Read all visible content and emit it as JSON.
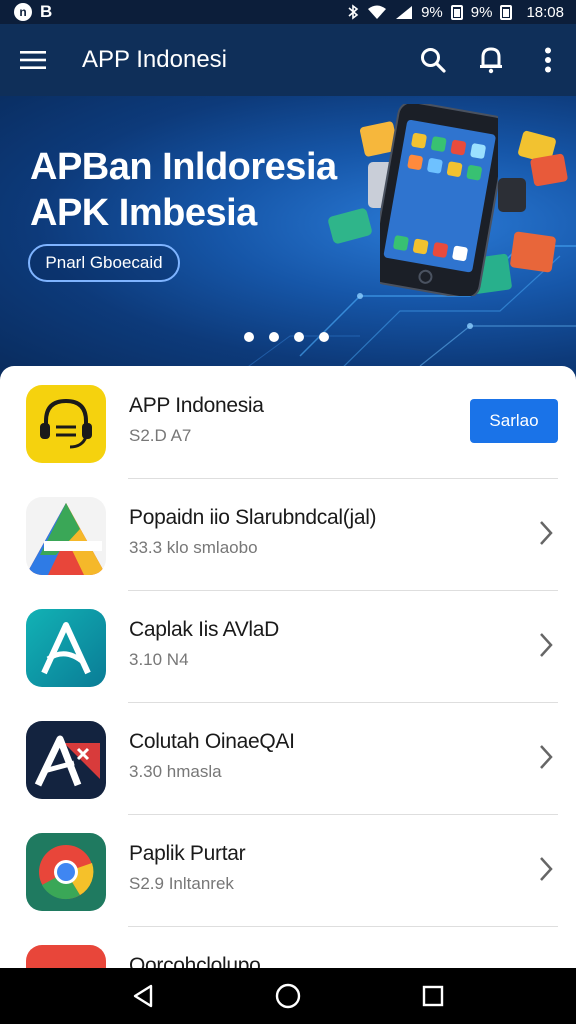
{
  "status_bar": {
    "left_icons": [
      "notification-icon",
      "b-icon"
    ],
    "left_glyphs": [
      "n",
      "B"
    ],
    "battery_1": "9%",
    "battery_2": "9%",
    "time": "18:08"
  },
  "app_bar": {
    "title": "APP Indonesi",
    "icons": [
      "menu-icon",
      "search-icon",
      "notification-bell-icon",
      "more-vert-icon"
    ],
    "color": "#0f2f59"
  },
  "hero": {
    "title_line1": "APBan Inldoresia",
    "title_line2": "APK Imbesia",
    "cta_label": "Pnarl Gboecaid",
    "carousel_dots": 4
  },
  "apps": [
    {
      "name": "APP Indonesia",
      "sub": "S2.D A7",
      "icon": "headset-app-icon",
      "action": "Sarlao"
    },
    {
      "name": "Popaidn iio Slarubndcal(jal)",
      "sub": "33.3 klo smlaobo",
      "icon": "triangle-app-icon"
    },
    {
      "name": "Caplak Iis AVlaD",
      "sub": "3.10 N4",
      "icon": "letter-a-app-icon"
    },
    {
      "name": "Colutah OinaeQAI",
      "sub": "3.30 hmasla",
      "icon": "ax-app-icon"
    },
    {
      "name": "Paplik Purtar",
      "sub": "S2.9 Inltanrek",
      "icon": "chrome-app-icon"
    },
    {
      "name": "Oorcohclolupo",
      "sub": "",
      "icon": "chrome-red-app-icon"
    }
  ],
  "colors": {
    "accent": "#1a73e8",
    "hero": "#1656a8"
  },
  "nav_bar": {
    "icons": [
      "back-icon",
      "home-icon",
      "recents-icon"
    ]
  }
}
